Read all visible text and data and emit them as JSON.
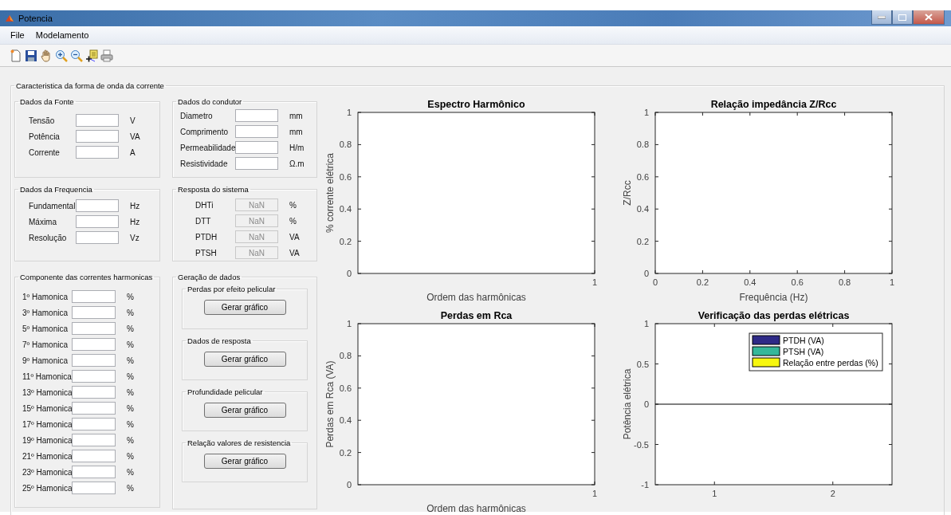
{
  "window": {
    "title": "Potencia"
  },
  "menu": [
    "File",
    "Modelamento"
  ],
  "main_panel": {
    "title": "Caracteristica da forma de onda da corrente",
    "source": {
      "title": "Dados da Fonte",
      "fields": [
        {
          "label": "Tensão",
          "unit": "V"
        },
        {
          "label": "Potência",
          "unit": "VA"
        },
        {
          "label": "Corrente",
          "unit": "A"
        }
      ]
    },
    "conductor": {
      "title": "Dados do condutor",
      "fields": [
        {
          "label": "Diametro",
          "unit": "mm"
        },
        {
          "label": "Comprimento",
          "unit": "mm"
        },
        {
          "label": "Permeabilidade",
          "unit": "H/m"
        },
        {
          "label": "Resistividade",
          "unit": "Ω.m"
        }
      ]
    },
    "frequency": {
      "title": "Dados da Frequencia",
      "fields": [
        {
          "label": "Fundamental",
          "unit": "Hz"
        },
        {
          "label": "Máxima",
          "unit": "Hz"
        },
        {
          "label": "Resolução",
          "unit": "Vz"
        }
      ]
    },
    "response": {
      "title": "Resposta do sistema",
      "fields": [
        {
          "label": "DHTi",
          "value": "NaN",
          "unit": "%",
          "disabled": true
        },
        {
          "label": "DTT",
          "value": "NaN",
          "unit": "%",
          "disabled": true
        },
        {
          "label": "PTDH",
          "value": "NaN",
          "unit": "VA",
          "disabled": true
        },
        {
          "label": "PTSH",
          "value": "NaN",
          "unit": "VA",
          "disabled": true
        }
      ]
    },
    "harmonics": {
      "title": "Componente das correntes harmonicas",
      "fields": [
        {
          "label": "1º Hamonica",
          "unit": "%"
        },
        {
          "label": "3º Hamonica",
          "unit": "%"
        },
        {
          "label": "5º Hamonica",
          "unit": "%"
        },
        {
          "label": "7º Hamonica",
          "unit": "%"
        },
        {
          "label": "9º Hamonica",
          "unit": "%"
        },
        {
          "label": "11º Hamonica",
          "unit": "%"
        },
        {
          "label": "13º Hamonica",
          "unit": "%"
        },
        {
          "label": "15º Hamonica",
          "unit": "%"
        },
        {
          "label": "17º Hamonica",
          "unit": "%"
        },
        {
          "label": "19º Hamonica",
          "unit": "%"
        },
        {
          "label": "21º Hamonica",
          "unit": "%"
        },
        {
          "label": "23º Hamonica",
          "unit": "%"
        },
        {
          "label": "25º Hamonica",
          "unit": "%"
        }
      ]
    },
    "generation": {
      "title": "Geração de dados",
      "groups": [
        {
          "title": "Perdas por efeito pelicular",
          "button": "Gerar gráfico"
        },
        {
          "title": "Dados de resposta",
          "button": "Gerar gráfico"
        },
        {
          "title": "Profundidade pelicular",
          "button": "Gerar gráfico"
        },
        {
          "title": "Relação valores de resistencia",
          "button": "Gerar gráfico"
        }
      ]
    }
  },
  "charts": [
    {
      "title": "Espectro Harmônico",
      "xlabel": "Ordem das harmônicas",
      "ylabel": "% corrente elétrica",
      "x_tick_labels": [
        "1"
      ],
      "y_tick_labels": [
        "1",
        "0.8",
        "0.6",
        "0.4",
        "0.2",
        "0"
      ]
    },
    {
      "chart_data": {
        "type": "line",
        "title": "Relação impedância Z/Rcc",
        "xlabel": "Frequência (Hz)",
        "ylabel": "Z/Rcc",
        "xlim": [
          0,
          1
        ],
        "ylim": [
          0,
          1
        ],
        "xticks": [
          0,
          0.2,
          0.4,
          0.6,
          0.8,
          1
        ],
        "yticks": [
          0,
          0.2,
          0.4,
          0.6,
          0.8,
          1
        ]
      }
    },
    {
      "title": "Perdas em Rca",
      "xlabel": "Ordem das harmônicas",
      "ylabel": "Perdas em Rca (VA)",
      "x_tick_labels": [
        "1"
      ],
      "y_tick_labels": [
        "1",
        "0.8",
        "0.6",
        "0.4",
        "0.2",
        "0"
      ]
    },
    {
      "chart_data": {
        "type": "bar",
        "title": "Verificação das perdas elétricas",
        "ylabel": "Potência elétrica",
        "categories": [
          "1",
          "2"
        ],
        "ylim": [
          -1,
          1
        ],
        "yticks": [
          -1,
          -0.5,
          0,
          0.5,
          1
        ],
        "series": [
          {
            "name": "PTDH (VA)",
            "color": "#2e2a87",
            "values": [
              null,
              null
            ]
          },
          {
            "name": "PTSH (VA)",
            "color": "#35b79a",
            "values": [
              null,
              null
            ]
          },
          {
            "name": "Relação entre perdas (%)",
            "color": "#f7f70e",
            "values": [
              null,
              null
            ]
          }
        ]
      }
    }
  ]
}
